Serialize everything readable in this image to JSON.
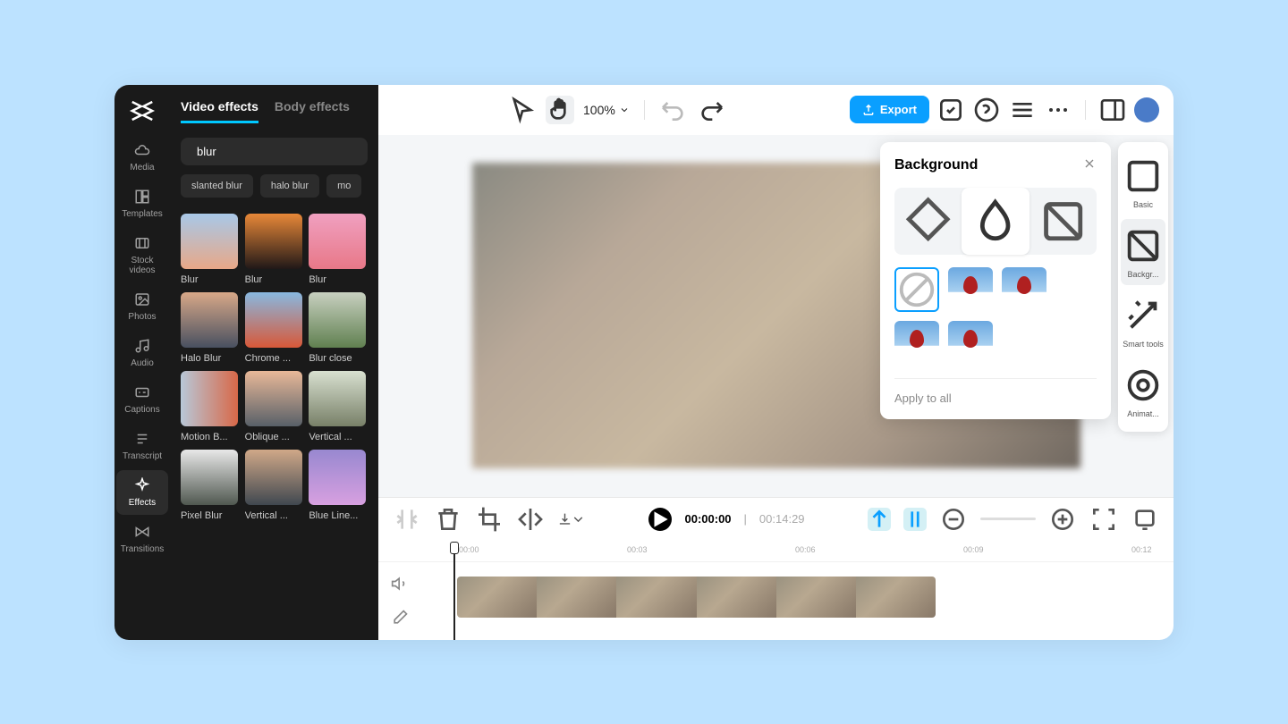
{
  "leftnav": {
    "items": [
      {
        "label": "Media"
      },
      {
        "label": "Templates"
      },
      {
        "label": "Stock videos"
      },
      {
        "label": "Photos"
      },
      {
        "label": "Audio"
      },
      {
        "label": "Captions"
      },
      {
        "label": "Transcript"
      },
      {
        "label": "Effects"
      },
      {
        "label": "Transitions"
      }
    ]
  },
  "panel": {
    "tabs": {
      "video": "Video effects",
      "body": "Body effects"
    },
    "search": {
      "value": "blur"
    },
    "chips": [
      "slanted blur",
      "halo blur",
      "mo"
    ],
    "effects": [
      "Blur",
      "Blur",
      "Blur",
      "Halo Blur",
      "Chrome ...",
      "Blur close",
      "Motion B...",
      "Oblique ...",
      "Vertical ...",
      "Pixel Blur",
      "Vertical ...",
      "Blue Line..."
    ]
  },
  "topbar": {
    "zoom": "100%",
    "export": "Export"
  },
  "background": {
    "title": "Background",
    "apply": "Apply to all"
  },
  "rightbar": {
    "items": [
      "Basic",
      "Backgr...",
      "Smart tools",
      "Animat..."
    ]
  },
  "timeline": {
    "current": "00:00:00",
    "duration": "00:14:29",
    "ticks": [
      "00:00",
      "00:03",
      "00:06",
      "00:09",
      "00:12"
    ]
  }
}
